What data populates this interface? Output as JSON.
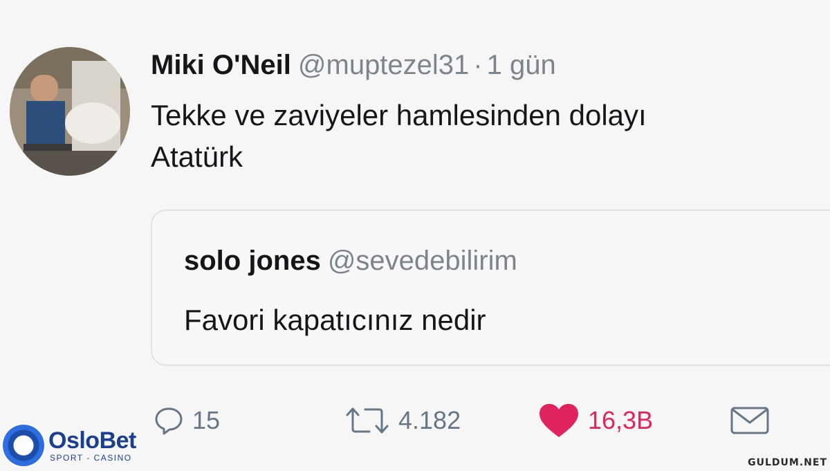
{
  "tweet": {
    "author_name": "Miki O'Neil",
    "author_handle": "@muptezel31",
    "separator": "·",
    "timestamp": "1 gün",
    "text_line1": "Tekke ve zaviyeler hamlesinden dolayı",
    "text_line2": "Atatürk"
  },
  "quoted_tweet": {
    "author_name": "solo jones",
    "author_handle": "@sevedebilirim",
    "text": "Favori kapatıcınız nedir"
  },
  "actions": {
    "reply_count": "15",
    "retweet_count": "4.182",
    "like_count": "16,3B"
  },
  "icons": {
    "reply": "reply-icon",
    "retweet": "retweet-icon",
    "like": "heart-icon",
    "message": "envelope-icon"
  },
  "colors": {
    "like": "#e0245e",
    "muted": "#7c858e",
    "text": "#14171a",
    "brand": "#1b3e8f"
  },
  "branding": {
    "logo_brand": "OsloBet",
    "logo_sub": "SPORT - CASINO",
    "watermark": "GULDUM.NET"
  }
}
